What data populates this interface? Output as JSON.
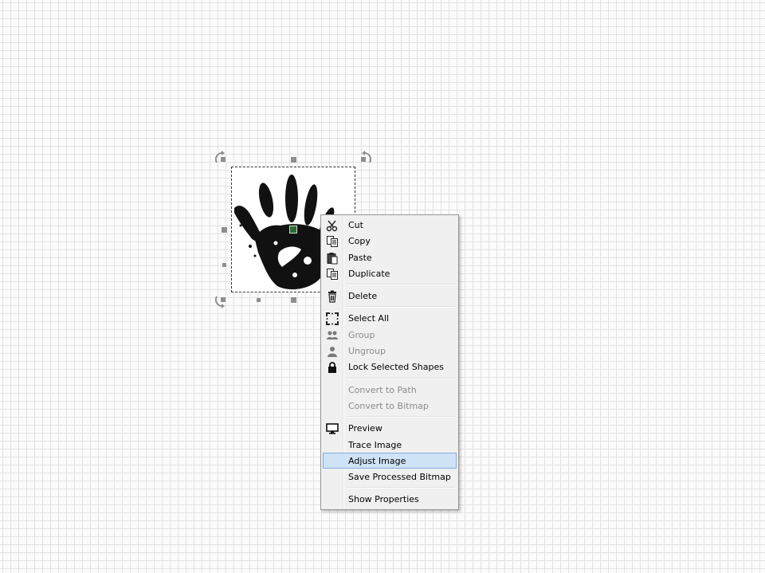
{
  "canvas": {
    "grid_color": "#e2e2e2",
    "background_color": "#fbfbfb"
  },
  "selected_shape": {
    "type": "image",
    "icon": "handprint-image"
  },
  "context_menu": {
    "groups": [
      [
        {
          "label": "Cut",
          "icon": "scissors-icon",
          "enabled": true
        },
        {
          "label": "Copy",
          "icon": "copy-icon",
          "enabled": true
        },
        {
          "label": "Paste",
          "icon": "paste-icon",
          "enabled": true
        },
        {
          "label": "Duplicate",
          "icon": "duplicate-icon",
          "enabled": true
        }
      ],
      [
        {
          "label": "Delete",
          "icon": "trash-icon",
          "enabled": true
        }
      ],
      [
        {
          "label": "Select All",
          "icon": "select-all-icon",
          "enabled": true
        },
        {
          "label": "Group",
          "icon": "group-icon",
          "enabled": false
        },
        {
          "label": "Ungroup",
          "icon": "ungroup-icon",
          "enabled": false
        },
        {
          "label": "Lock Selected Shapes",
          "icon": "lock-icon",
          "enabled": true
        }
      ],
      [
        {
          "label": "Convert to Path",
          "icon": "",
          "enabled": false
        },
        {
          "label": "Convert to Bitmap",
          "icon": "",
          "enabled": false
        }
      ],
      [
        {
          "label": "Preview",
          "icon": "monitor-icon",
          "enabled": true
        },
        {
          "label": "Trace Image",
          "icon": "",
          "enabled": true
        },
        {
          "label": "Adjust Image",
          "icon": "",
          "enabled": true,
          "highlighted": true
        },
        {
          "label": "Save Processed Bitmap",
          "icon": "",
          "enabled": true
        }
      ],
      [
        {
          "label": "Show Properties",
          "icon": "",
          "enabled": true
        }
      ]
    ]
  }
}
